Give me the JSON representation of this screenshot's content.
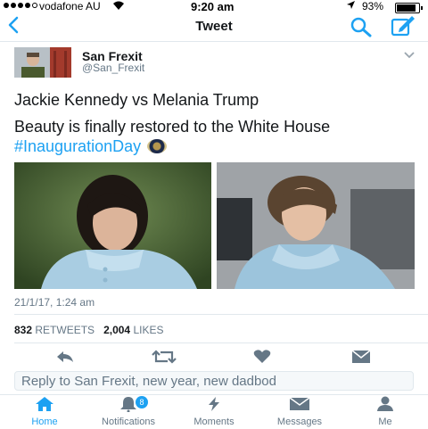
{
  "status_bar": {
    "carrier": "vodafone AU",
    "time": "9:20 am",
    "battery": "93%"
  },
  "nav": {
    "title": "Tweet",
    "back_icon": "chevron-left-icon",
    "search_icon": "search-icon",
    "compose_icon": "compose-icon"
  },
  "tweet": {
    "author_name": "San Frexit",
    "author_handle": "@San_Frexit",
    "line1": "Jackie Kennedy vs Melania Trump",
    "line2_text": "Beauty is finally restored to the White House ",
    "hashtag": "#InaugurationDay",
    "timestamp": "21/1/17, 1:24 am",
    "retweets_count": "832",
    "retweets_label": "RETWEETS",
    "likes_count": "2,004",
    "likes_label": "LIKES"
  },
  "reply": {
    "placeholder": "Reply to San Frexit, new year, new dadbod"
  },
  "tabs": [
    {
      "label": "Home",
      "icon": "home-icon",
      "active": true
    },
    {
      "label": "Notifications",
      "icon": "bell-icon",
      "badge": "8"
    },
    {
      "label": "Moments",
      "icon": "lightning-icon"
    },
    {
      "label": "Messages",
      "icon": "envelope-icon"
    },
    {
      "label": "Me",
      "icon": "person-icon"
    }
  ],
  "colors": {
    "accent": "#1da1f2",
    "secondary_text": "#657786"
  }
}
